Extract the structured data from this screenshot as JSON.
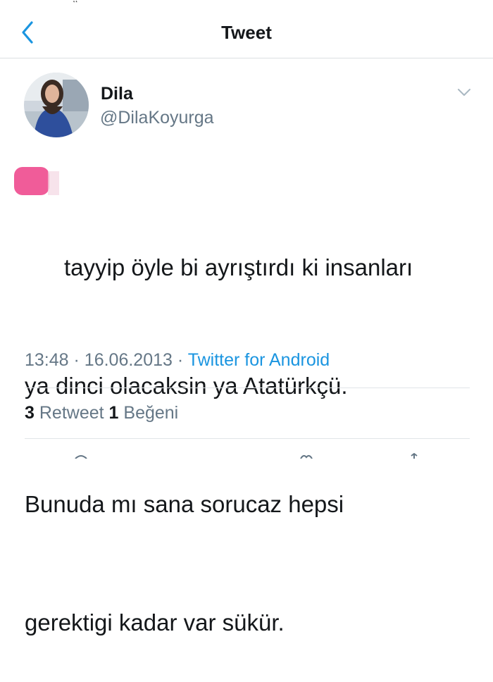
{
  "header": {
    "title": "Tweet",
    "back_icon": "chevron-left-icon",
    "accent": "#1b95e0"
  },
  "tweet": {
    "display_name": "Dila",
    "handle": "@DilaKoyurga",
    "more_icon": "chevron-down-icon",
    "text_lines": [
      "tayyip öyle bi ayrıştırdı ki insanları",
      "ya dinci olacaksin ya Atatürkçü.",
      "Bunuda mı sana sorucaz hepsi",
      "gerektigi kadar var sükür."
    ],
    "time": "13:48",
    "separator": "·",
    "date": "16.06.2013",
    "source": "Twitter for Android",
    "retweet_count": "3",
    "retweet_label": "Retweet",
    "like_count": "1",
    "like_label": "Beğeni"
  }
}
